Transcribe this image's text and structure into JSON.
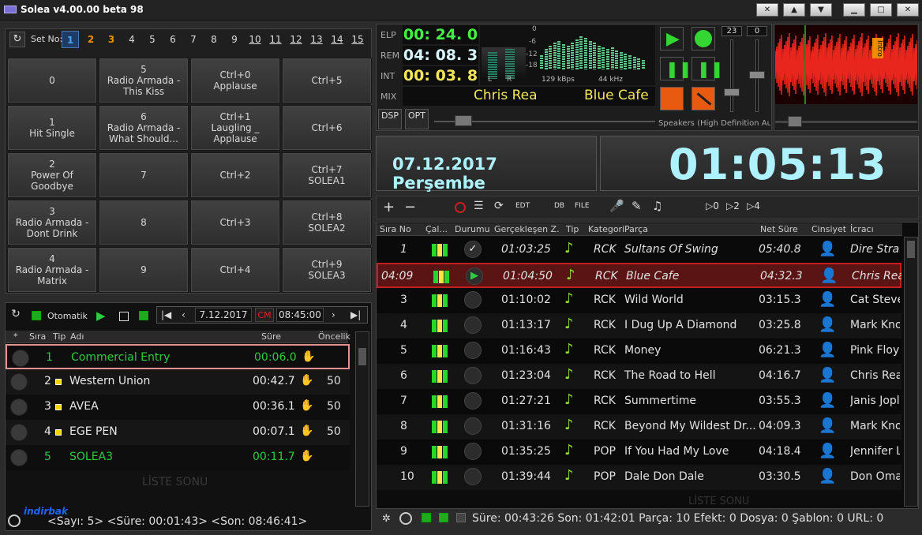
{
  "window": {
    "title": "Solea v4.00.00 beta 98"
  },
  "pads": {
    "set_label": "Set No:",
    "set_numbers": [
      "1",
      "2",
      "3",
      "4",
      "5",
      "6",
      "7",
      "8",
      "9",
      "10",
      "11",
      "12",
      "13",
      "14",
      "15"
    ],
    "buttons": [
      [
        "0",
        "5\nRadio Armada -\nThis Kiss",
        "Ctrl+0\nApplause",
        "Ctrl+5"
      ],
      [
        "1\nHit Single",
        "6\nRadio Armada -\nWhat Should...",
        "Ctrl+1\nLaugling _\nApplause",
        "Ctrl+6"
      ],
      [
        "2\nPower Of Goodbye",
        "7",
        "Ctrl+2",
        "Ctrl+7\nSOLEA1"
      ],
      [
        "3\nRadio Armada -\nDont Drink",
        "8",
        "Ctrl+3",
        "Ctrl+8\nSOLEA2"
      ],
      [
        "4\nRadio Armada -\nMatrix",
        "9",
        "Ctrl+4",
        "Ctrl+9\nSOLEA3"
      ]
    ]
  },
  "schedule": {
    "mode_label": "Otomatik",
    "date": "7.12.2017",
    "cm": "CM",
    "time": "08:45:00",
    "headers": [
      "*",
      "Sıra",
      "Tip",
      "Adı",
      "Süre",
      "Öncelik"
    ],
    "rows": [
      {
        "n": "1",
        "name": "Commercial Entry",
        "dur": "00:06.0",
        "pri": "",
        "green": true
      },
      {
        "n": "2",
        "name": "Western Union",
        "dur": "00:42.7",
        "pri": "50",
        "green": false
      },
      {
        "n": "3",
        "name": "AVEA",
        "dur": "00:36.1",
        "pri": "50",
        "green": false
      },
      {
        "n": "4",
        "name": "EGE PEN",
        "dur": "00:07.1",
        "pri": "50",
        "green": false
      },
      {
        "n": "5",
        "name": "SOLEA3",
        "dur": "00:11.7",
        "pri": "",
        "green": true
      }
    ],
    "end_label": "LİSTE SONU",
    "status": "<Sayı: 5>   <Süre: 00:01:43>   <Son: 08:46:41>",
    "watermark": "indirbak"
  },
  "player": {
    "elp_label": "ELP",
    "elp": "00: 24. 0",
    "rem_label": "REM",
    "rem": "04: 08. 3",
    "int_label": "INT",
    "int": "00: 03. 8",
    "mix_label": "MIX",
    "artist": "Chris Rea",
    "song": "Blue Cafe",
    "meter_l": "L",
    "meter_r": "R",
    "db_marks": [
      "0",
      "-6",
      "-12",
      "-18"
    ],
    "kbps": "129 kBps",
    "khz": "44 kHz",
    "dsp": "DSP",
    "opt": "OPT",
    "output": "Speakers (High Definition Aud",
    "vol1": "23",
    "vol2": "0",
    "intro_tag": "Intro"
  },
  "date_display": "07.12.2017  Perşembe",
  "clock": "01:05:13",
  "toolbar": {
    "edt": "EDT",
    "db": "DB",
    "file": "FILE"
  },
  "playlist": {
    "headers": [
      "Sıra No",
      "Çal...",
      "Durumu",
      "Gerçekleşen Z.",
      "Tip",
      "Kategori",
      "Parça",
      "Net Süre",
      "Cinsiyet",
      "İcracı"
    ],
    "rows": [
      {
        "no": "1",
        "time": "01:03:25",
        "cat": "RCK",
        "title": "Sultans Of Swing",
        "dur": "05:40.8",
        "artist": "Dire Straits",
        "state": "done",
        "italic": true
      },
      {
        "no": "04:09",
        "time": "01:04:50",
        "cat": "RCK",
        "title": "Blue Cafe",
        "dur": "04:32.3",
        "artist": "Chris Rea",
        "state": "playing",
        "italic": true
      },
      {
        "no": "3",
        "time": "01:10:02",
        "cat": "RCK",
        "title": "Wild World",
        "dur": "03:15.3",
        "artist": "Cat Stevens",
        "state": "wait",
        "italic": false
      },
      {
        "no": "4",
        "time": "01:13:17",
        "cat": "RCK",
        "title": "I Dug Up A Diamond",
        "dur": "03:25.8",
        "artist": "Mark Knopfler",
        "state": "wait",
        "italic": false
      },
      {
        "no": "5",
        "time": "01:16:43",
        "cat": "RCK",
        "title": "Money",
        "dur": "06:21.3",
        "artist": "Pink Floyd",
        "state": "wait",
        "italic": false
      },
      {
        "no": "6",
        "time": "01:23:04",
        "cat": "RCK",
        "title": "The Road to Hell",
        "dur": "04:16.7",
        "artist": "Chris Rea",
        "state": "wait",
        "italic": false
      },
      {
        "no": "7",
        "time": "01:27:21",
        "cat": "RCK",
        "title": "Summertime",
        "dur": "03:55.3",
        "artist": "Janis Joplin",
        "state": "wait",
        "italic": false
      },
      {
        "no": "8",
        "time": "01:31:16",
        "cat": "RCK",
        "title": "Beyond My Wildest Dr...",
        "dur": "04:09.3",
        "artist": "Mark Knopfler",
        "state": "wait",
        "italic": false
      },
      {
        "no": "9",
        "time": "01:35:25",
        "cat": "POP",
        "title": "If You Had My Love",
        "dur": "04:18.4",
        "artist": "Jennifer Lopez",
        "state": "wait",
        "italic": false
      },
      {
        "no": "10",
        "time": "01:39:44",
        "cat": "POP",
        "title": "Dale Don Dale",
        "dur": "03:30.5",
        "artist": "Don Omar",
        "state": "wait",
        "italic": false
      }
    ],
    "end_label": "LİSTE SONU",
    "status": "Süre: 00:43:26   Son: 01:42:01   Parça: 10   Efekt: 0   Dosya: 0   Şablon: 0   URL: 0"
  },
  "colors": {
    "accent_green": "#2ecc40",
    "clock_cyan": "#aef2ff",
    "row_playing": "#5a1414",
    "led_green": "#29d629",
    "led_yellow": "#ffe14a"
  }
}
